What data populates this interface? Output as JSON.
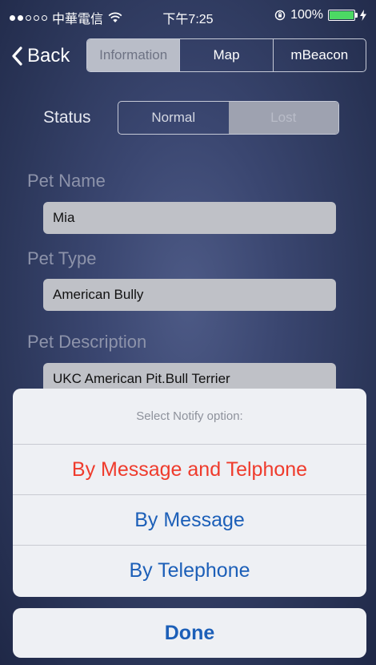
{
  "status_bar": {
    "carrier": "中華電信",
    "time": "下午7:25",
    "battery": "100%",
    "battery_level": 1.0,
    "signal_bars_filled": 2,
    "signal_bars_total": 5
  },
  "nav": {
    "back_label": "Back",
    "tabs": [
      {
        "label": "Information",
        "selected": true
      },
      {
        "label": "Map",
        "selected": false
      },
      {
        "label": "mBeacon",
        "selected": false
      }
    ]
  },
  "status": {
    "label": "Status",
    "options": [
      {
        "label": "Normal",
        "selected": false
      },
      {
        "label": "Lost",
        "selected": true
      }
    ]
  },
  "form": {
    "pet_name_label": "Pet Name",
    "pet_name_value": "Mia",
    "pet_type_label": "Pet Type",
    "pet_type_value": "American Bully",
    "pet_description_label": "Pet Description",
    "pet_description_value": "UKC American Pit.Bull Terrier"
  },
  "action_sheet": {
    "title": "Select Notify option:",
    "options": [
      {
        "label": "By Message and Telphone"
      },
      {
        "label": "By Message"
      },
      {
        "label": "By Telephone"
      }
    ],
    "done_label": "Done"
  },
  "colors": {
    "destructive": "#ef3b2c",
    "accent": "#1c5fb8",
    "battery": "#4cd964"
  }
}
